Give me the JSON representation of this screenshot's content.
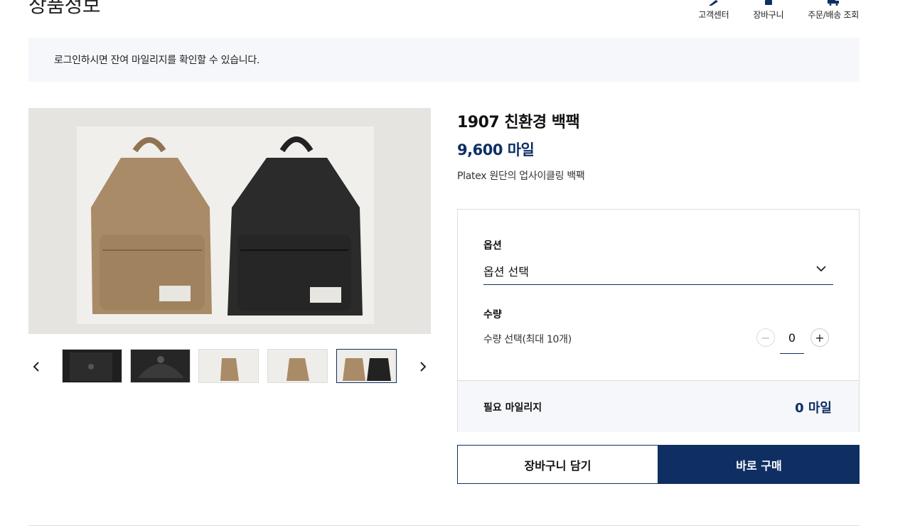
{
  "page": {
    "title": "상품정보"
  },
  "nav": [
    {
      "label": "고객센터",
      "icon": "pen-icon"
    },
    {
      "label": "장바구니",
      "icon": "cart-icon"
    },
    {
      "label": "주문/배송 조회",
      "icon": "truck-icon"
    }
  ],
  "notice": {
    "text": "로그인하시면 잔여 마일리지를 확인할 수 있습니다."
  },
  "product": {
    "name": "1907 친환경 백팩",
    "price": "9,600 마일",
    "description": "Platex 원단의 업사이클링 백팩"
  },
  "options": {
    "option_label": "옵션",
    "option_value": "옵션 선택",
    "quantity_label": "수량",
    "quantity_hint": "수량 선택(최대 10개)",
    "quantity_value": "0",
    "total_label": "필요 마일리지",
    "total_value": "0 마일"
  },
  "buttons": {
    "cart": "장바구니 담기",
    "buy": "바로 구매"
  },
  "gallery": {
    "active_index": 4,
    "thumb_count": 5
  },
  "colors": {
    "accent": "#0f2f63",
    "panel_bg": "#f5f7fb",
    "border": "#dddddd"
  }
}
